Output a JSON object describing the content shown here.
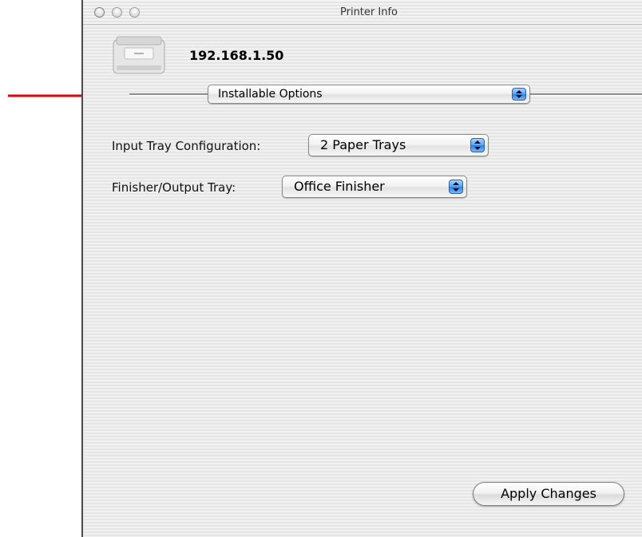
{
  "window": {
    "title": "Printer Info"
  },
  "printer": {
    "name": "192.168.1.50",
    "icon": "printer-icon"
  },
  "options_menu": {
    "selected": "Installable Options"
  },
  "settings": {
    "input_tray": {
      "label": "Input Tray Configuration:",
      "selected": "2 Paper Trays"
    },
    "finisher": {
      "label": "Finisher/Output Tray:",
      "selected": "Office Finisher"
    }
  },
  "actions": {
    "apply_label": "Apply Changes"
  },
  "colors": {
    "annotation_arrow": "#e8000b",
    "popup_accent": "#3a8ef0"
  }
}
